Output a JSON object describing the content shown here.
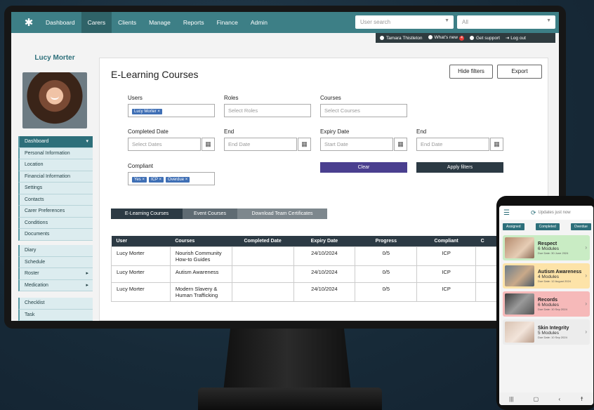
{
  "nav": {
    "logo": "✱",
    "items": [
      "Dashboard",
      "Carers",
      "Clients",
      "Manage",
      "Reports",
      "Finance",
      "Admin"
    ],
    "search_placeholder": "User search",
    "all_value": "All"
  },
  "subbar": {
    "user": "Tamara Thistleton",
    "whats_new": "What's new",
    "whats_new_count": "4",
    "support": "Get support",
    "logout": "Log out"
  },
  "profile": {
    "name": "Lucy Morter"
  },
  "menu_group1": [
    "Dashboard",
    "Personal Information",
    "Location",
    "Financial Information",
    "Settings",
    "Contacts",
    "Carer Preferences",
    "Conditions",
    "Documents"
  ],
  "menu_group2": [
    "Diary",
    "Schedule",
    "Roster",
    "Medication"
  ],
  "menu_group3": [
    "Checklist",
    "Task"
  ],
  "page": {
    "title": "E-Learning Courses",
    "hide_filters": "Hide filters",
    "export": "Export"
  },
  "filters": {
    "users_label": "Users",
    "users_tag": "Lucy Morter",
    "roles_label": "Roles",
    "roles_placeholder": "Select Roles",
    "courses_label": "Courses",
    "courses_placeholder": "Select Courses",
    "completed_label": "Completed Date",
    "completed_placeholder": "Select Dates",
    "end_label": "End",
    "end_placeholder": "End Date",
    "expiry_label": "Expiry Date",
    "expiry_placeholder": "Start Date",
    "end2_label": "End",
    "end2_placeholder": "End Date",
    "compliant_label": "Compliant",
    "compliant_tags": [
      "Yes",
      "ICP",
      "Overdue"
    ],
    "clear": "Clear",
    "apply": "Apply filters"
  },
  "tabs": [
    "E-Learning Courses",
    "Event Courses",
    "Download Team Certificates"
  ],
  "table": {
    "headers": [
      "User",
      "Courses",
      "Completed Date",
      "Expiry Date",
      "Progress",
      "Compliant",
      "C"
    ],
    "rows": [
      {
        "user": "Lucy Morter",
        "course1": "Nourish Community",
        "course2": "How-to Guides",
        "completed": "",
        "expiry": "24/10/2024",
        "progress": "0/5",
        "compliant": "ICP"
      },
      {
        "user": "Lucy Morter",
        "course1": "Autism Awareness",
        "course2": "",
        "completed": "",
        "expiry": "24/10/2024",
        "progress": "0/5",
        "compliant": "ICP"
      },
      {
        "user": "Lucy Morter",
        "course1": "Modern Slavery &",
        "course2": "Human Trafficking",
        "completed": "",
        "expiry": "24/10/2024",
        "progress": "0/5",
        "compliant": "ICP"
      }
    ]
  },
  "phone": {
    "header": "Updates just now",
    "chips": [
      "Assigned",
      "Completed",
      "Overdue"
    ],
    "cards": [
      {
        "title": "Respect",
        "modules": "6 Modules",
        "due": "Due Date: 30 June 2024",
        "color": "#c9ecc4"
      },
      {
        "title": "Autism Awareness",
        "modules": "4 Modules",
        "due": "Due Date: 12 August 2024",
        "color": "#fde3a8"
      },
      {
        "title": "Records",
        "modules": "6 Modules",
        "due": "Due Date: 10 Sep 2024",
        "color": "#f6b9b9"
      },
      {
        "title": "Skin Integrity",
        "modules": "5 Modules",
        "due": "Due Date: 10 Sep 2024",
        "color": "#ececec"
      }
    ]
  },
  "colors": {
    "teal": "#3d7f86",
    "dark": "#2c3a44",
    "clear_btn": "#4a3f8f"
  }
}
